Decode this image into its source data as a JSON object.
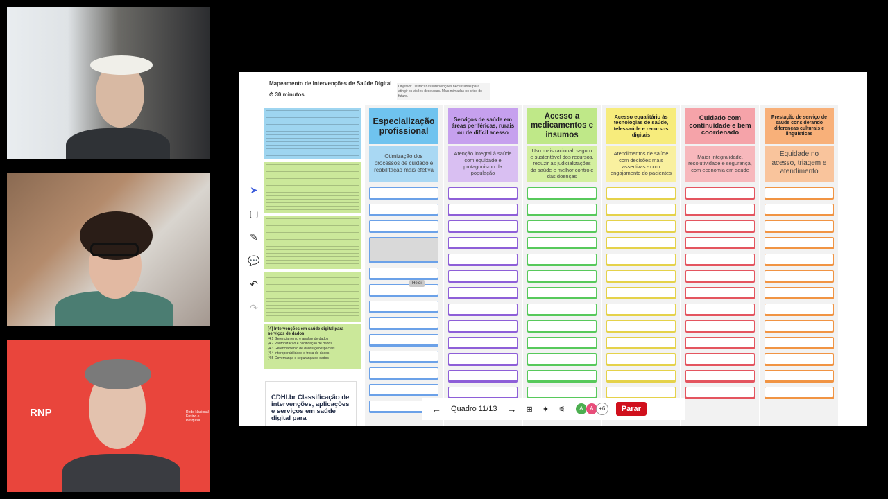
{
  "participants": {
    "rnp_logo": "RNP",
    "rnp_subtitle": "Rede Nacional de Ensino e Pesquisa"
  },
  "board": {
    "title": "Mapeamento de Intervenções de Saúde Digital",
    "timer": "30 minutos",
    "objective": "Objetivo: Destacar as intervenções necessárias para atingir os visões desejadas. Mais mimadas no crise do futuro."
  },
  "columns": [
    {
      "header": "Especialização profissional",
      "sub": "Otimização dos processos de cuidado e reabilitação mais efetiva",
      "color": "#6fc3ef",
      "subcolor": "#a9d8f3",
      "card_color": "#6ba1e8"
    },
    {
      "header": "Serviços de saúde em áreas periféricas, rurais ou de difícil acesso",
      "sub": "Atenção integral à saúde com equidade e protagonismo da população",
      "color": "#c6a0ee",
      "subcolor": "#d9bff2",
      "card_color": "#8e5fd8"
    },
    {
      "header": "Acesso a medicamentos e insumos",
      "sub": "Uso mais racional, seguro e sustentável dos recursos, reduzir as judicializações da saúde e melhor controle das doenças",
      "color": "#bfe888",
      "subcolor": "#d3ef9f",
      "card_color": "#57c95b"
    },
    {
      "header": "Acesso equalitário às tecnologias de saúde, telessaúde e recursos digitais",
      "sub": "Atendimentos de saúde com decisões mais assertivas - com engajamento do pacientes",
      "color": "#f7ec7c",
      "subcolor": "#f9f09f",
      "card_color": "#e5d24a"
    },
    {
      "header": "Cuidado com continuidade e bem coordenado",
      "sub": "Maior integralidade, resolutividade e segurança, com economia em saúde",
      "color": "#f5a3a9",
      "subcolor": "#f7b8bc",
      "card_color": "#e4555f"
    },
    {
      "header": "Prestação de serviço de saúde considerando diferenças culturais e linguísticas",
      "sub": "Equidade no acesso, triagem e atendimento",
      "color": "#f8b079",
      "subcolor": "#f9c49c",
      "card_color": "#f19443"
    }
  ],
  "left_notes": {
    "final_title": "[4] Intervenções em saúde digital para serviços de dados",
    "final_items": [
      "[4.1 Gerenciamento e análise de dados",
      "[4.2 Padronização e codificação de dados",
      "[4.3 Gerenciamento de dados geoespaciais",
      "[4.4 Interoperabilidade e troca de dados",
      "[4.5 Governança e segurança de dados"
    ],
    "doc_title": "CDHI.br Classificação de intervenções, aplicações e serviços em saúde digital para"
  },
  "cursor_label": "Heidi",
  "toolbar": {
    "prev": "←",
    "frame": "Quadro 11/13",
    "next": "→",
    "avatars": [
      "A",
      "A"
    ],
    "more": "+6",
    "stop": "Parar"
  }
}
